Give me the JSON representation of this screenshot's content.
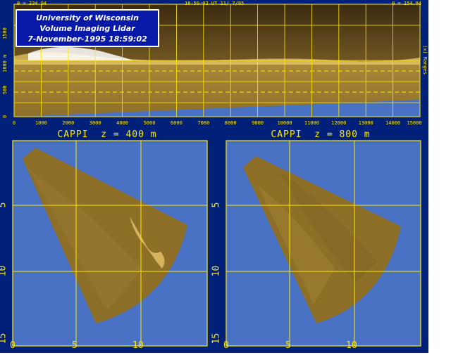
{
  "window": {
    "az_left": "θ = 334.94",
    "timestamp": "18:59:02 UT 11/ 7/95",
    "az_right": "θ = 154.94"
  },
  "title_box": {
    "line1": "University of Wisconsin",
    "line2": "Volume Imaging Lidar",
    "line3": "7-November-1995 18:59:02"
  },
  "rhi": {
    "y_axis_label": "1000 m",
    "y_ticks": [
      "0",
      "500",
      "1500"
    ],
    "x_ticks": [
      "0",
      "1000",
      "2000",
      "3000",
      "4000",
      "5000",
      "6000",
      "7000",
      "8000",
      "9000",
      "10000",
      "11000",
      "12000",
      "13000",
      "14000",
      "15000"
    ],
    "right_label": "(x) Ranges"
  },
  "panels": [
    {
      "title": "CAPPI  z = 400 m",
      "x_ticks": [
        "0",
        "5",
        "10"
      ],
      "y_ticks": [
        "5",
        "10",
        "15"
      ]
    },
    {
      "title": "CAPPI  z = 800 m",
      "x_ticks": [
        "0",
        "5",
        "10"
      ],
      "y_ticks": [
        "5",
        "10",
        "15"
      ]
    }
  ],
  "colors": {
    "frame": "#00207a",
    "sky": "#4a72c4",
    "grid": "#ffe800",
    "aerosol": "#8e6f28"
  }
}
